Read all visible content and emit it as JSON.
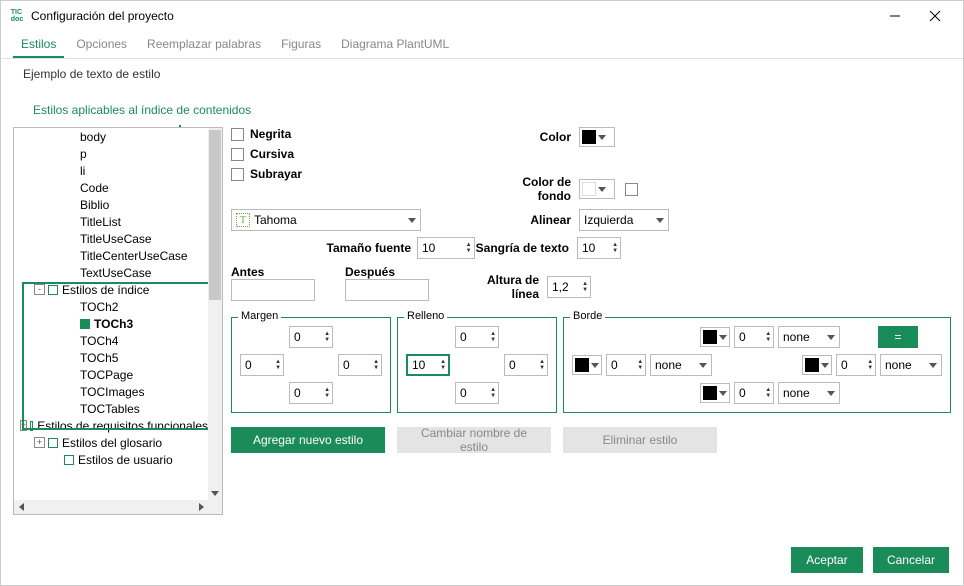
{
  "window": {
    "title": "Configuración del proyecto",
    "app_icon": "TIC\ndoc"
  },
  "tabs": [
    {
      "label": "Estilos",
      "active": true
    },
    {
      "label": "Opciones",
      "active": false
    },
    {
      "label": "Reemplazar palabras",
      "active": false
    },
    {
      "label": "Figuras",
      "active": false
    },
    {
      "label": "Diagrama PlantUML",
      "active": false
    }
  ],
  "subtitle": "Ejemplo  de  texto  de  estilo",
  "heading": "Estilos aplicables al índice de contenidos",
  "tree": [
    {
      "indent": 3,
      "name": "body"
    },
    {
      "indent": 3,
      "name": "p"
    },
    {
      "indent": 3,
      "name": "li"
    },
    {
      "indent": 3,
      "name": "Code"
    },
    {
      "indent": 3,
      "name": "Biblio"
    },
    {
      "indent": 3,
      "name": "TitleList"
    },
    {
      "indent": 3,
      "name": "TitleUseCase"
    },
    {
      "indent": 3,
      "name": "TitleCenterUseCase"
    },
    {
      "indent": 3,
      "name": "TextUseCase"
    },
    {
      "indent": 1,
      "exp": "-",
      "icon": "open",
      "name": "Estilos de índice"
    },
    {
      "indent": 3,
      "name": "TOCh2"
    },
    {
      "indent": 3,
      "icon": "filled",
      "name": "TOCh3",
      "selected": true
    },
    {
      "indent": 3,
      "name": "TOCh4"
    },
    {
      "indent": 3,
      "name": "TOCh5"
    },
    {
      "indent": 3,
      "name": "TOCPage"
    },
    {
      "indent": 3,
      "name": "TOCImages"
    },
    {
      "indent": 3,
      "name": "TOCTables"
    },
    {
      "indent": 1,
      "exp": "+",
      "icon": "open",
      "name": "Estilos de requisitos funcionales"
    },
    {
      "indent": 1,
      "exp": "+",
      "icon": "open",
      "name": "Estilos del glosario"
    },
    {
      "indent": 2,
      "icon": "open",
      "name": "Estilos de usuario"
    }
  ],
  "form": {
    "bold": "Negrita",
    "italic": "Cursiva",
    "underline": "Subrayar",
    "color_label": "Color",
    "color_value": "#000000",
    "bgcolor_label": "Color de fondo",
    "bgcolor_value": "#ffffff",
    "font_value": "Tahoma",
    "align_label": "Alinear",
    "align_value": "Izquierda",
    "fontsize_label": "Tamaño fuente",
    "fontsize_value": "10",
    "textindent_label": "Sangría de texto",
    "textindent_value": "10",
    "before_label": "Antes",
    "before_value": "",
    "after_label": "Después",
    "after_value": "",
    "lineheight_label": "Altura de línea",
    "lineheight_value": "1,2",
    "margin": {
      "legend": "Margen",
      "top": "0",
      "left": "0",
      "right": "0",
      "bottom": "0"
    },
    "padding": {
      "legend": "Relleno",
      "top": "0",
      "left": "10",
      "right": "0",
      "bottom": "0"
    },
    "border": {
      "legend": "Borde",
      "eq": "=",
      "top": {
        "color": "#000000",
        "width": "0",
        "style": "none"
      },
      "left": {
        "color": "#000000",
        "width": "0",
        "style": "none"
      },
      "right": {
        "color": "#000000",
        "width": "0",
        "style": "none"
      },
      "bottom": {
        "color": "#000000",
        "width": "0",
        "style": "none"
      }
    }
  },
  "actions": {
    "add": "Agregar nuevo estilo",
    "rename": "Cambiar nombre de estilo",
    "delete": "Eliminar estilo"
  },
  "footer": {
    "ok": "Aceptar",
    "cancel": "Cancelar"
  }
}
